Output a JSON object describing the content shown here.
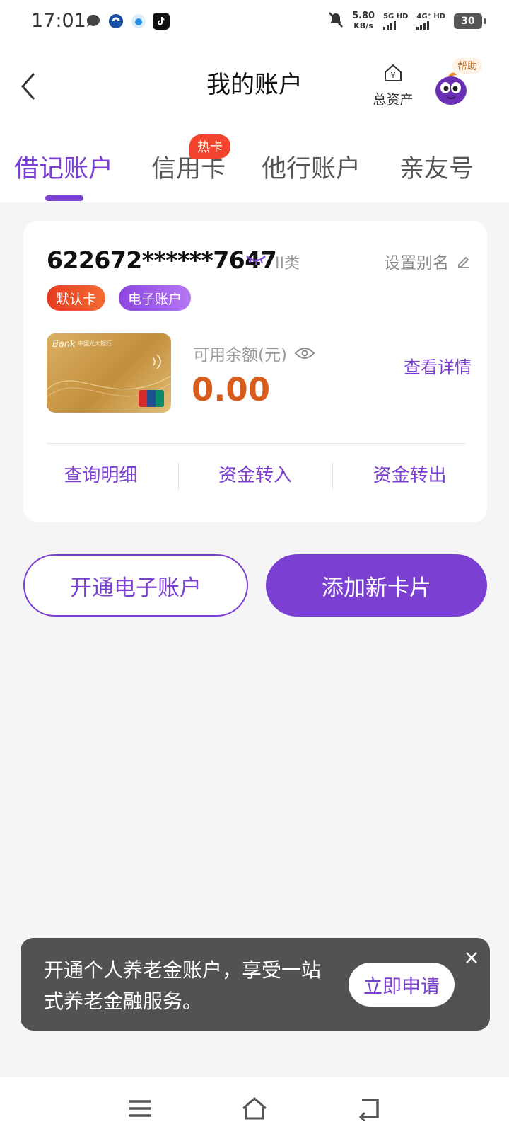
{
  "status_bar": {
    "time": "17:01",
    "speed_value": "5.80",
    "speed_unit": "KB/s",
    "network_1": "5G HD",
    "network_2": "4G⁺ HD",
    "battery": "30"
  },
  "header": {
    "title": "我的账户",
    "assets_label": "总资产",
    "help_label": "帮助"
  },
  "tabs": [
    {
      "label": "借记账户",
      "active": true
    },
    {
      "label": "信用卡",
      "active": false,
      "badge": "热卡"
    },
    {
      "label": "他行账户",
      "active": false
    },
    {
      "label": "亲友号",
      "active": false
    }
  ],
  "account": {
    "number": "622672******7647",
    "type": "II类",
    "alias_label": "设置别名",
    "badges": [
      "默认卡",
      "电子账户"
    ],
    "balance_label": "可用余额(元)",
    "balance": "0.00",
    "detail_link": "查看详情",
    "actions": [
      "查询明细",
      "资金转入",
      "资金转出"
    ],
    "card_logo": "Bank",
    "card_bank_name": "中国光大银行"
  },
  "buttons": {
    "open_eaccount": "开通电子账户",
    "add_card": "添加新卡片"
  },
  "banner": {
    "text": "开通个人养老金账户，享受一站式养老金融服务。",
    "apply": "立即申请"
  },
  "colors": {
    "accent": "#7b3fd2",
    "balance": "#d85d1d",
    "hot": "#f2432e"
  }
}
